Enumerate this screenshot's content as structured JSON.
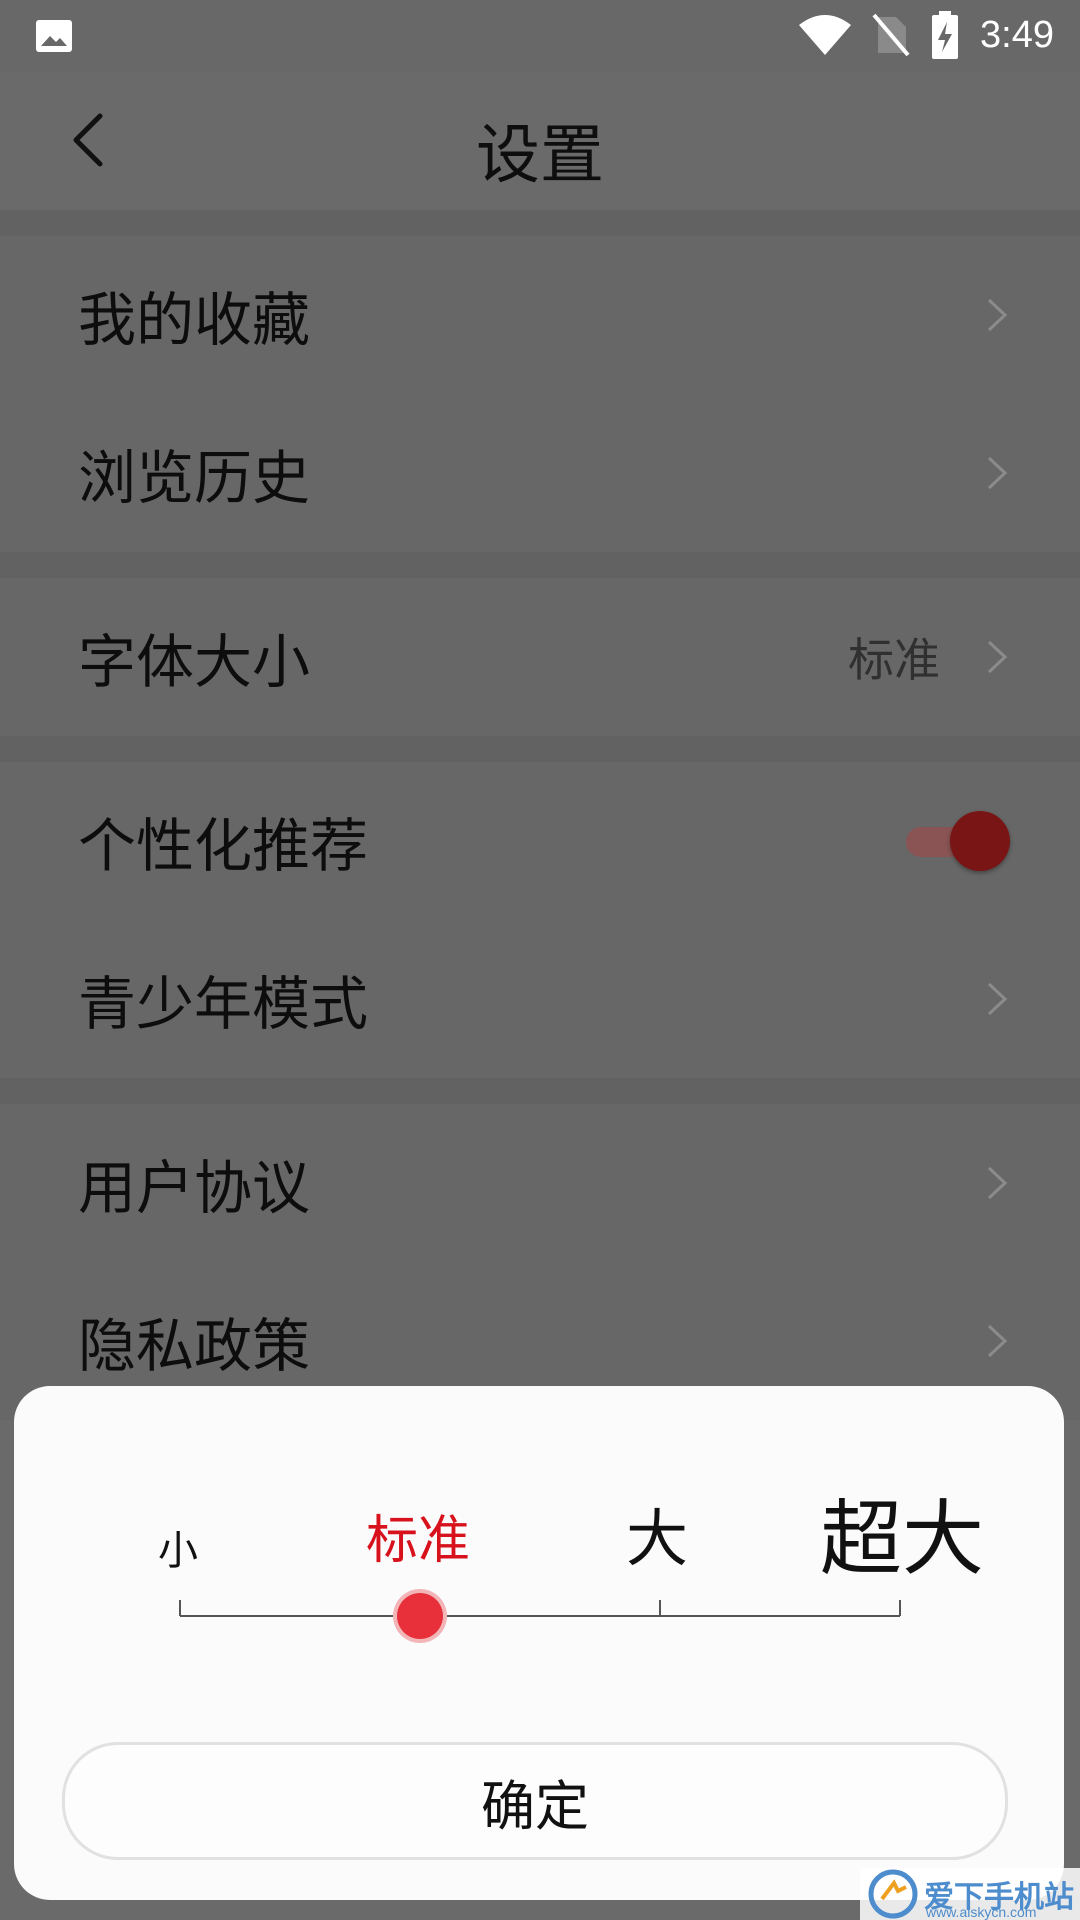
{
  "status_bar": {
    "time": "3:49",
    "icons": [
      "image-icon",
      "wifi-icon",
      "no-sim-icon",
      "battery-charging-icon"
    ]
  },
  "header": {
    "title": "设置",
    "back_icon": "chevron-left-icon"
  },
  "groups": [
    {
      "items": [
        {
          "label": "我的收藏"
        },
        {
          "label": "浏览历史"
        }
      ]
    },
    {
      "items": [
        {
          "label": "字体大小",
          "value": "标准"
        }
      ]
    },
    {
      "items": [
        {
          "label": "个性化推荐",
          "toggle": true
        },
        {
          "label": "青少年模式"
        }
      ]
    },
    {
      "items": [
        {
          "label": "用户协议"
        },
        {
          "label": "隐私政策"
        }
      ]
    }
  ],
  "font_sheet": {
    "options": [
      "小",
      "标准",
      "大",
      "超大"
    ],
    "selected_index": 1,
    "confirm_label": "确定",
    "accent_color": "#d7121c"
  },
  "watermark": {
    "text": "爱下手机站",
    "url": "www.aiskycn.com"
  }
}
